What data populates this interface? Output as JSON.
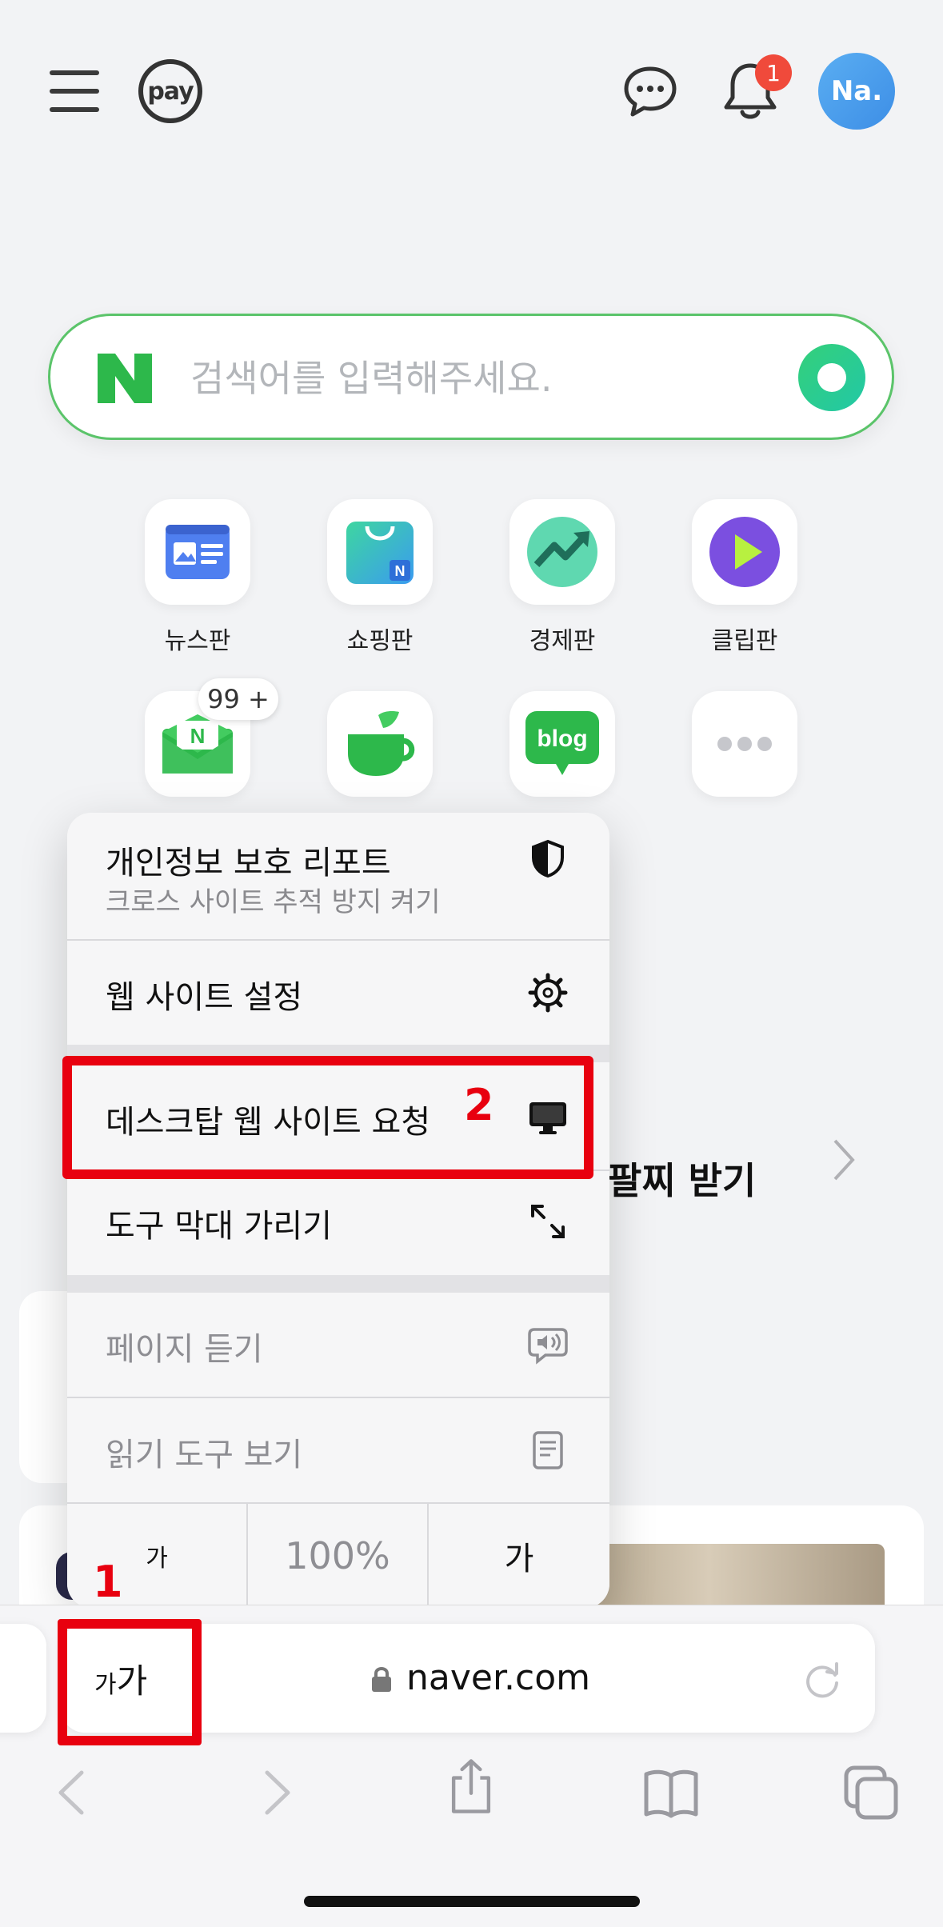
{
  "header": {
    "pay_label": "pay",
    "notification_count": "1",
    "avatar_label": "Na."
  },
  "search": {
    "placeholder": "검색어를 입력해주세요."
  },
  "apps": [
    {
      "label": "뉴스판"
    },
    {
      "label": "쇼핑판"
    },
    {
      "label": "경제판"
    },
    {
      "label": "클립판"
    }
  ],
  "mail_badge": "99 +",
  "background_promo": "팔찌 받기",
  "menu": {
    "privacy_title": "개인정보 보호 리포트",
    "privacy_sub": "크로스 사이트 추적 방지 켜기",
    "website_settings": "웹 사이트 설정",
    "request_desktop": "데스크탑 웹 사이트 요청",
    "hide_toolbar": "도구 막대 가리기",
    "listen_page": "페이지 듣기",
    "reader_view": "읽기 도구 보기",
    "font_smaller": "가",
    "zoom_level": "100%",
    "font_larger": "가"
  },
  "annotations": {
    "step1": "1",
    "step2": "2"
  },
  "browser": {
    "aa_small": "가",
    "aa_large": "가",
    "url": "naver.com"
  },
  "colors": {
    "accent_green": "#5bc46a",
    "annotation_red": "#e8000f",
    "badge_red": "#f04a3b"
  }
}
